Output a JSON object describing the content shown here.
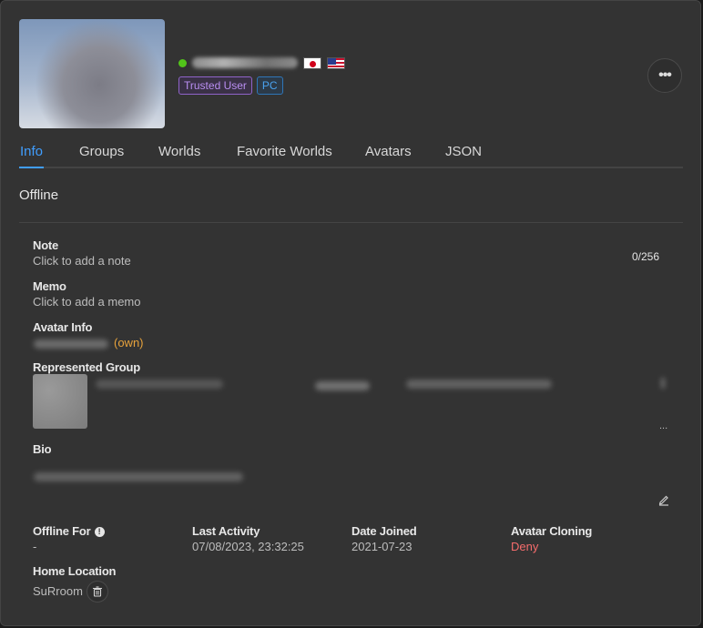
{
  "profile": {
    "status_color": "#52c41a",
    "badges": [
      "Trusted User",
      "PC"
    ],
    "flags": [
      "flag-jp-icon",
      "flag-us-icon"
    ],
    "more_label": "•••"
  },
  "tabs": [
    "Info",
    "Groups",
    "Worlds",
    "Favorite Worlds",
    "Avatars",
    "JSON"
  ],
  "active_tab": "Info",
  "status_heading": "Offline",
  "note": {
    "label": "Note",
    "placeholder": "Click to add a note",
    "counter": "0/256"
  },
  "memo": {
    "label": "Memo",
    "placeholder": "Click to add a memo"
  },
  "avatar_info": {
    "label": "Avatar Info",
    "suffix": "(own)"
  },
  "represented_group": {
    "label": "Represented Group",
    "more_label": "..."
  },
  "bio": {
    "label": "Bio"
  },
  "stats": {
    "offline_for": {
      "label": "Offline For",
      "value": "-"
    },
    "last_activity": {
      "label": "Last Activity",
      "value": "07/08/2023, 23:32:25"
    },
    "date_joined": {
      "label": "Date Joined",
      "value": "2021-07-23"
    },
    "avatar_cloning": {
      "label": "Avatar Cloning",
      "value": "Deny"
    }
  },
  "home_location": {
    "label": "Home Location",
    "value": "SuRroom"
  },
  "colors": {
    "accent": "#409eff",
    "deny": "#f56c6c",
    "own": "#e6a23c",
    "trusted": "#b98ef2"
  }
}
